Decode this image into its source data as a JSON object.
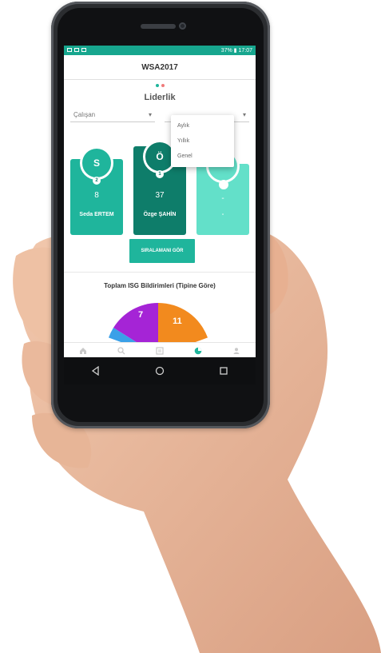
{
  "status": {
    "right_text": "37% ▮ 17:07"
  },
  "app": {
    "title": "WSA2017"
  },
  "pager": {
    "active_color": "#1fb59c",
    "inactive_color": "#f07b7b"
  },
  "section": {
    "title": "Liderlik"
  },
  "filters": {
    "left_select": "Çalışan",
    "dropdown_options": [
      "Aylık",
      "Yıllık",
      "Genel"
    ]
  },
  "leaders": [
    {
      "initial": "S",
      "rank": "2",
      "score": "8",
      "name": "Seda ERTEM",
      "color": "#1fb59c"
    },
    {
      "initial": "Ö",
      "rank": "1",
      "score": "37",
      "name": "Özge ŞAHİN",
      "color": "#0e7d6a"
    },
    {
      "initial": "",
      "rank": "",
      "score": "-",
      "name": "-",
      "color": "#63e0c9"
    }
  ],
  "actions": {
    "ranking_button": "SIRALAMANI GÖR"
  },
  "chart_data": {
    "type": "pie",
    "title": "Toplam ISG Bildirimleri (Tipine Göre)",
    "slices": [
      {
        "value": 7,
        "color": "#a524d6"
      },
      {
        "value": 11,
        "color": "#f28a1e"
      },
      {
        "value": null,
        "color": "#3aa0e8"
      }
    ]
  },
  "tabbar": {
    "items": [
      "home-icon",
      "search-icon",
      "list-icon",
      "chart-icon",
      "profile-icon"
    ],
    "active_index": 3,
    "active_color": "#1fb59c"
  }
}
